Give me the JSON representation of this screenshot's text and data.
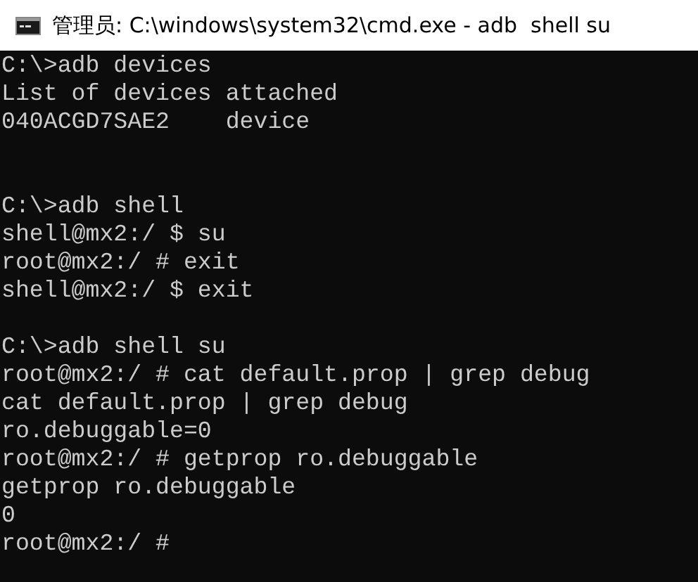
{
  "window": {
    "title": "管理员: C:\\windows\\system32\\cmd.exe - adb  shell su"
  },
  "console": {
    "lines": [
      {
        "kind": "text",
        "text": "C:\\>adb devices"
      },
      {
        "kind": "text",
        "text": "List of devices attached"
      },
      {
        "kind": "text",
        "text": "040ACGD7SAE2    device"
      },
      {
        "kind": "blank"
      },
      {
        "kind": "blank"
      },
      {
        "kind": "text",
        "text": "C:\\>adb shell"
      },
      {
        "kind": "text",
        "text": "shell@mx2:/ $ su"
      },
      {
        "kind": "text",
        "text": "root@mx2:/ # exit"
      },
      {
        "kind": "text",
        "text": "shell@mx2:/ $ exit"
      },
      {
        "kind": "blank"
      },
      {
        "kind": "text",
        "text": "C:\\>adb shell su"
      },
      {
        "kind": "text",
        "text": "root@mx2:/ # cat default.prop | grep debug"
      },
      {
        "kind": "text",
        "text": "cat default.prop | grep debug"
      },
      {
        "kind": "text",
        "text": "ro.debuggable=0"
      },
      {
        "kind": "text",
        "text": "root@mx2:/ # getprop ro.debuggable"
      },
      {
        "kind": "text",
        "text": "getprop ro.debuggable"
      },
      {
        "kind": "text",
        "text": "0"
      },
      {
        "kind": "text",
        "text": "root@mx2:/ #"
      }
    ]
  }
}
